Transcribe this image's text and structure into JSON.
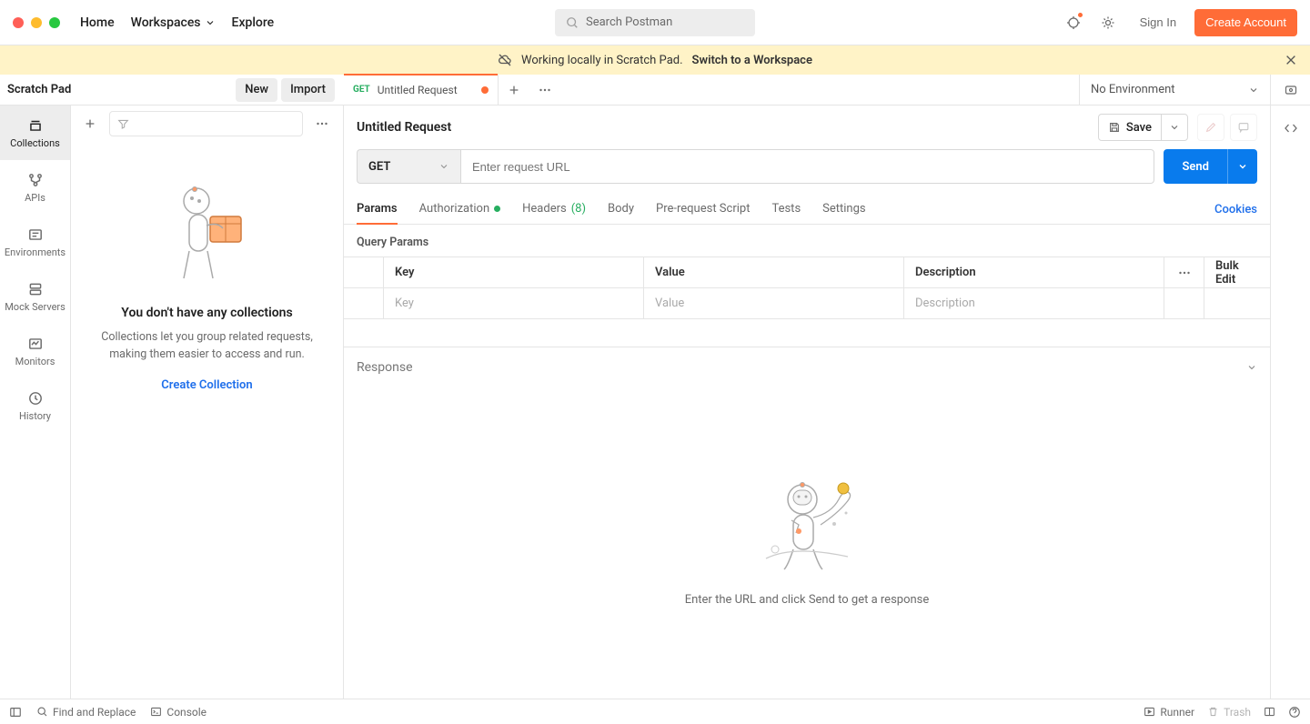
{
  "top": {
    "nav": {
      "home": "Home",
      "workspaces": "Workspaces",
      "explore": "Explore"
    },
    "search_placeholder": "Search Postman",
    "sign_in": "Sign In",
    "create_account": "Create Account"
  },
  "banner": {
    "text": "Working locally in Scratch Pad.",
    "cta": "Switch to a Workspace"
  },
  "workspace": {
    "title": "Scratch Pad",
    "new": "New",
    "import": "Import"
  },
  "tabs": {
    "method": "GET",
    "title": "Untitled Request"
  },
  "env": {
    "label": "No Environment"
  },
  "rail": {
    "collections": "Collections",
    "apis": "APIs",
    "environments": "Environments",
    "mock_servers": "Mock Servers",
    "monitors": "Monitors",
    "history": "History"
  },
  "sidebar": {
    "empty_title": "You don't have any collections",
    "empty_desc": "Collections let you group related requests, making them easier to access and run.",
    "create": "Create Collection"
  },
  "request": {
    "name": "Untitled Request",
    "save": "Save",
    "method": "GET",
    "url_placeholder": "Enter request URL",
    "send": "Send",
    "tabs": {
      "params": "Params",
      "auth": "Authorization",
      "headers": "Headers",
      "headers_count": "(8)",
      "body": "Body",
      "prereq": "Pre-request Script",
      "tests": "Tests",
      "settings": "Settings",
      "cookies": "Cookies"
    },
    "section_label": "Query Params",
    "columns": {
      "key": "Key",
      "value": "Value",
      "desc": "Description",
      "bulk": "Bulk Edit"
    },
    "placeholders": {
      "key": "Key",
      "value": "Value",
      "desc": "Description"
    }
  },
  "response": {
    "label": "Response",
    "empty_msg": "Enter the URL and click Send to get a response"
  },
  "status": {
    "find": "Find and Replace",
    "console": "Console",
    "runner": "Runner",
    "trash": "Trash"
  }
}
